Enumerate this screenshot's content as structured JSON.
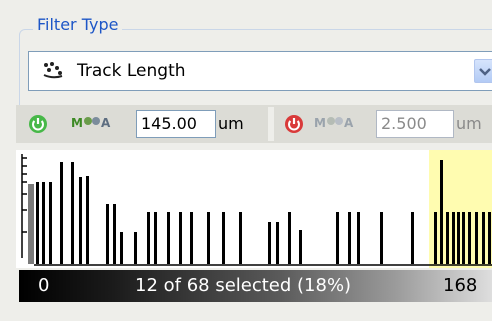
{
  "filter": {
    "legend": "Filter Type",
    "selected_type": "Track Length",
    "type_icon": "track-icon",
    "dropdown_icon": "chevron-down-icon"
  },
  "threshold_low": {
    "value": "145.00",
    "unit": "um",
    "enabled_icon": "power-green-icon",
    "auto_label_m": "M",
    "auto_label_a": "A"
  },
  "threshold_high": {
    "value": "2.500",
    "unit": "um",
    "enabled_icon": "power-red-icon",
    "auto_label_m": "M",
    "auto_label_a": "A"
  },
  "histogram": {
    "min_label": "0",
    "max_label": "168",
    "selection_summary": "12 of 68 selected (18%)",
    "highlight_color": "#fffcb0",
    "bar_color": "#000000"
  }
}
